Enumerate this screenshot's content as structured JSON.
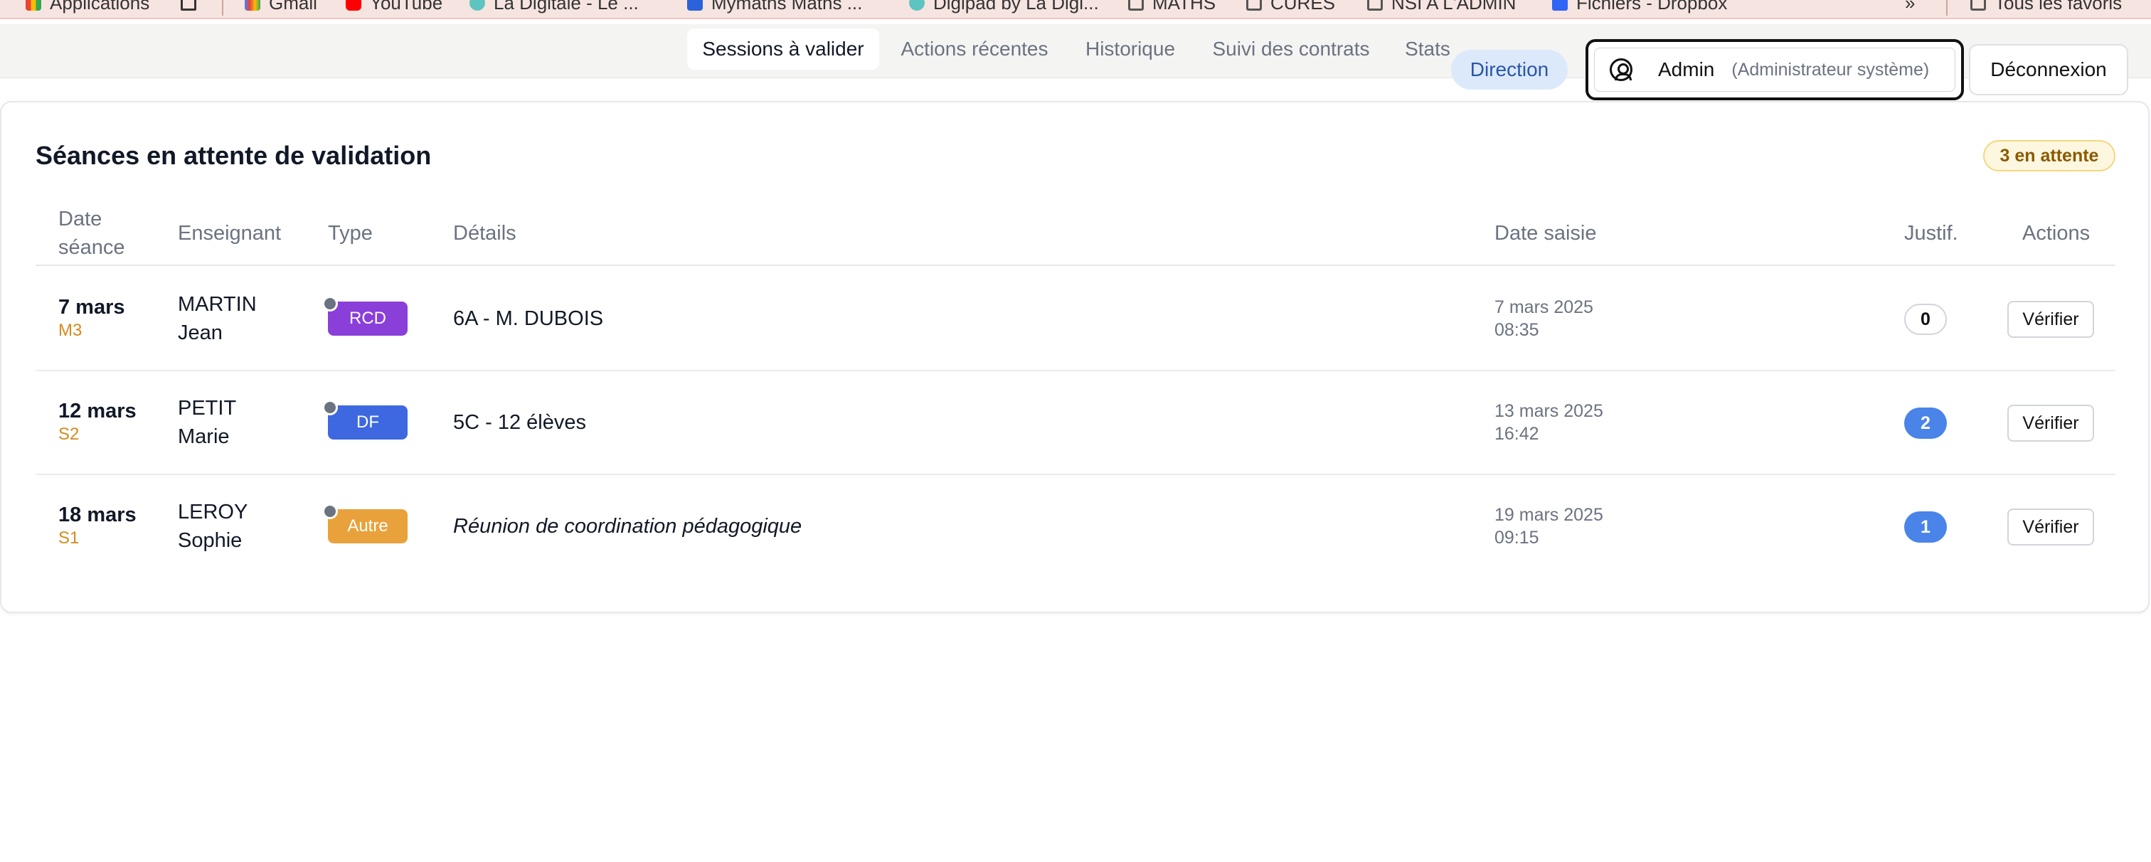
{
  "browser": {
    "bookmarks": [
      {
        "label": "Applications",
        "icon": "apps-grid-icon"
      },
      {
        "label": "",
        "icon": "tab-groups-icon"
      },
      {
        "label": "Gmail",
        "icon": "gmail-icon"
      },
      {
        "label": "YouTube",
        "icon": "youtube-icon"
      },
      {
        "label": "La Digitale - Le ...",
        "icon": "la-digitale-icon"
      },
      {
        "label": "Mymaths Maths ...",
        "icon": "mymaths-icon"
      },
      {
        "label": "Digipad by La Digi...",
        "icon": "digipad-icon"
      },
      {
        "label": "MATHS",
        "icon": "folder-icon"
      },
      {
        "label": "CURES",
        "icon": "folder-icon"
      },
      {
        "label": "NSI A L'ADMIN",
        "icon": "folder-icon"
      },
      {
        "label": "Fichiers - Dropbox",
        "icon": "dropbox-icon"
      },
      {
        "label": "»",
        "icon": ""
      },
      {
        "label": "Tous les favoris",
        "icon": "folder-icon"
      }
    ]
  },
  "nav": {
    "tabs": [
      {
        "label": "Sessions à valider",
        "active": true
      },
      {
        "label": "Actions récentes",
        "active": false
      },
      {
        "label": "Historique",
        "active": false
      },
      {
        "label": "Suivi des contrats",
        "active": false
      },
      {
        "label": "Stats",
        "active": false
      }
    ],
    "role_badge": "Direction",
    "user_name": "Admin",
    "user_role": "(Administrateur système)",
    "logout_label": "Déconnexion"
  },
  "card": {
    "title": "Séances en attente de validation",
    "pending_badge": "3 en attente"
  },
  "table": {
    "headers": {
      "date_line1": "Date",
      "date_line2": "séance",
      "teacher": "Enseignant",
      "type": "Type",
      "details": "Détails",
      "date_saisie": "Date saisie",
      "justif": "Justif.",
      "actions": "Actions"
    },
    "rows": [
      {
        "date": "7 mars",
        "slot": "M3",
        "last_name": "MARTIN",
        "first_name": "Jean",
        "type": "RCD",
        "type_color": "#8b3fd9",
        "details": "6A - M. DUBOIS",
        "details_italic": false,
        "saisie_date": "7 mars 2025",
        "saisie_time": "08:35",
        "justif": "0",
        "action": "Vérifier"
      },
      {
        "date": "12 mars",
        "slot": "S2",
        "last_name": "PETIT",
        "first_name": "Marie",
        "type": "DF",
        "type_color": "#3d68e0",
        "details": "5C - 12 élèves",
        "details_italic": false,
        "saisie_date": "13 mars 2025",
        "saisie_time": "16:42",
        "justif": "2",
        "action": "Vérifier"
      },
      {
        "date": "18 mars",
        "slot": "S1",
        "last_name": "LEROY",
        "first_name": "Sophie",
        "type": "Autre",
        "type_color": "#e9a23b",
        "details": "Réunion de coordination pédagogique",
        "details_italic": true,
        "saisie_date": "19 mars 2025",
        "saisie_time": "09:15",
        "justif": "1",
        "action": "Vérifier"
      }
    ]
  }
}
